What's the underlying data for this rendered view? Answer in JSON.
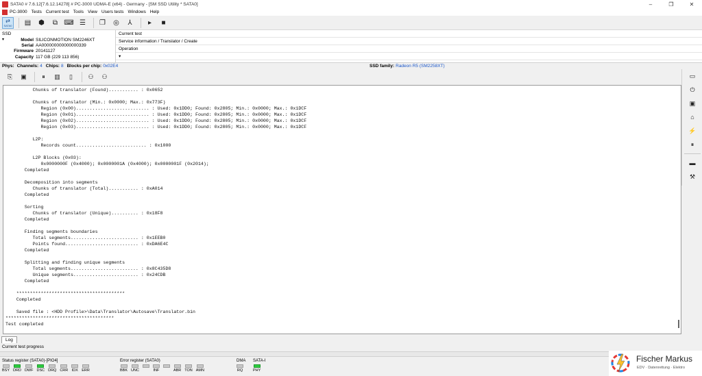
{
  "window": {
    "title": "SATA0 # 7.6.12[7.6.12.14278] # PC-3000 UDMA-E (x64) - Germany - [SM SSD Utility * SATA0]",
    "min": "–",
    "restore": "❐",
    "close": "✕"
  },
  "menu": [
    "PC-3000",
    "Tests",
    "Current test",
    "Tools",
    "View",
    "Users tests",
    "Windows",
    "Help"
  ],
  "toolbar": {
    "sata_label": "SATA0"
  },
  "ssd": {
    "section_label": "SSD",
    "arrow": "▾",
    "fields": [
      {
        "key": "Model",
        "value": "SILICONMOTION SM2246XT"
      },
      {
        "key": "Serial",
        "value": "AA000000000000000339"
      },
      {
        "key": "Firmware",
        "value": "20141127"
      },
      {
        "key": "Capacity",
        "value": "117 GB (229 113 856)"
      }
    ]
  },
  "current_test": {
    "header": "Current test",
    "value": "Service information / Translator / Create",
    "operation_label": "Operation",
    "operation_value": "▾"
  },
  "phys": {
    "label": "Phys:",
    "channels_label": "Channels:",
    "channels": "4",
    "chips_label": "Chips:",
    "chips": "8",
    "blocks_label": "Blocks per chip:",
    "blocks": "0x02E4",
    "family_label": "SSD family:",
    "family": "Radeon R5 (SM2258XT)"
  },
  "log": {
    "lines": [
      "          Chunks of translator (Found)........... : 0x0652",
      "",
      "          Chunks of translator (Min.: 0x0000; Max.: 0x773F)",
      "             Region (0x00)........................... : Used: 0x1DD0; Found: 0x2805; Min.: 0x0000; Max.: 0x1DCF",
      "             Region (0x01)........................... : Used: 0x1DD0; Found: 0x2805; Min.: 0x0000; Max.: 0x1DCF",
      "             Region (0x02)........................... : Used: 0x1DD0; Found: 0x2805; Min.: 0x0000; Max.: 0x1DCF",
      "             Region (0x03)........................... : Used: 0x1DD0; Found: 0x2805; Min.: 0x0000; Max.: 0x1DCF",
      "",
      "          L2P:",
      "             Records count.......................... : 0x1000",
      "",
      "          L2P Blocks (0x03):",
      "             0x0000000F (0x4000); 0x0000001A (0x4000); 0x0000001F (0x2014);",
      "       Completed",
      "",
      "       Decomposition into segments",
      "          Chunks of translator (Total)........... : 0xA014",
      "       Completed",
      "",
      "       Sorting",
      "          Chunks of translator (Unique).......... : 0x18F8",
      "       Completed",
      "",
      "       Finding segments boundaries",
      "          Total segments......................... : 0x1EEB0",
      "          Points found........................... : 0xDA6E4C",
      "       Completed",
      "",
      "       Splitting and finding unique segments",
      "          Total segments......................... : 0x8C435D8",
      "          Unique segments........................ : 0x24CDB",
      "       Completed",
      "",
      "    ****************************************",
      "    Completed",
      "",
      "    Saved file : <HDD Profile>\\Data\\Translator\\Autosave\\Translator.bin",
      "****************************************",
      "Test completed"
    ]
  },
  "tabs": {
    "log": "Log",
    "progress": "Current test progress"
  },
  "status": {
    "group1_title": "Status register (SATA0)-[PIO4]",
    "group1": [
      {
        "name": "BSY",
        "on": false
      },
      {
        "name": "DRD",
        "on": true
      },
      {
        "name": "DWF",
        "on": false
      },
      {
        "name": "DSC",
        "on": true
      },
      {
        "name": "DRQ",
        "on": false
      },
      {
        "name": "CRR",
        "on": false
      },
      {
        "name": "IDX",
        "on": false
      },
      {
        "name": "ERR",
        "on": false
      }
    ],
    "group2_title": "Error register (SATA0)",
    "group2": [
      {
        "name": "BBK",
        "on": false
      },
      {
        "name": "UNC",
        "on": false
      },
      {
        "name": "",
        "on": false
      },
      {
        "name": "INF",
        "on": false
      },
      {
        "name": "",
        "on": false
      },
      {
        "name": "ABR",
        "on": false
      },
      {
        "name": "TON",
        "on": false
      },
      {
        "name": "AMN",
        "on": false
      }
    ],
    "group3_title": "DMA",
    "group3": [
      {
        "name": "RQ",
        "on": false
      }
    ],
    "group4_title": "SATA-I",
    "group4": [
      {
        "name": "PHY",
        "on": true
      }
    ]
  },
  "logo": {
    "name": "Fischer Markus",
    "sub": "EDV · Datenrettung · Elektro"
  }
}
